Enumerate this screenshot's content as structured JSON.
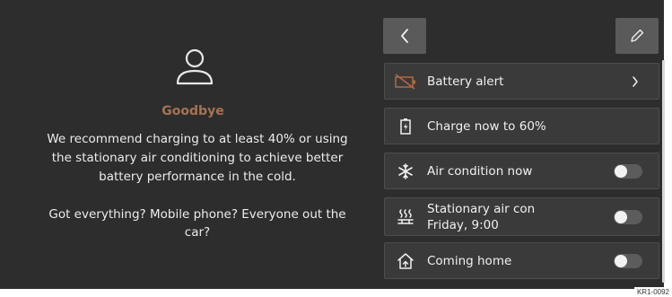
{
  "left": {
    "title": "Goodbye",
    "message": "We recommend charging to at least 40% or using the stationary air conditioning to achieve better battery performance in the cold.",
    "question": "Got everything? Mobile phone? Everyone out the car?",
    "icon": "person-icon"
  },
  "header": {
    "back_icon": "chevron-left-icon",
    "edit_icon": "pencil-icon"
  },
  "list": {
    "items": [
      {
        "label": "Battery alert",
        "icon": "battery-alert-icon",
        "control": "chevron"
      },
      {
        "label": "Charge now to 60%",
        "icon": "battery-charge-icon",
        "control": "none"
      },
      {
        "label": "Air condition now",
        "icon": "snowflake-icon",
        "control": "toggle",
        "toggle_on": false
      },
      {
        "label": "Stationary air con",
        "sublabel": "Friday, 9:00",
        "icon": "heating-icon",
        "control": "toggle",
        "toggle_on": false
      },
      {
        "label": "Coming home",
        "icon": "house-icon",
        "control": "toggle",
        "toggle_on": false
      }
    ]
  },
  "figure_ref": "KR1-0092",
  "colors": {
    "background": "#2d2d2d",
    "accent": "#a67254",
    "row": "#3a3a3a"
  }
}
